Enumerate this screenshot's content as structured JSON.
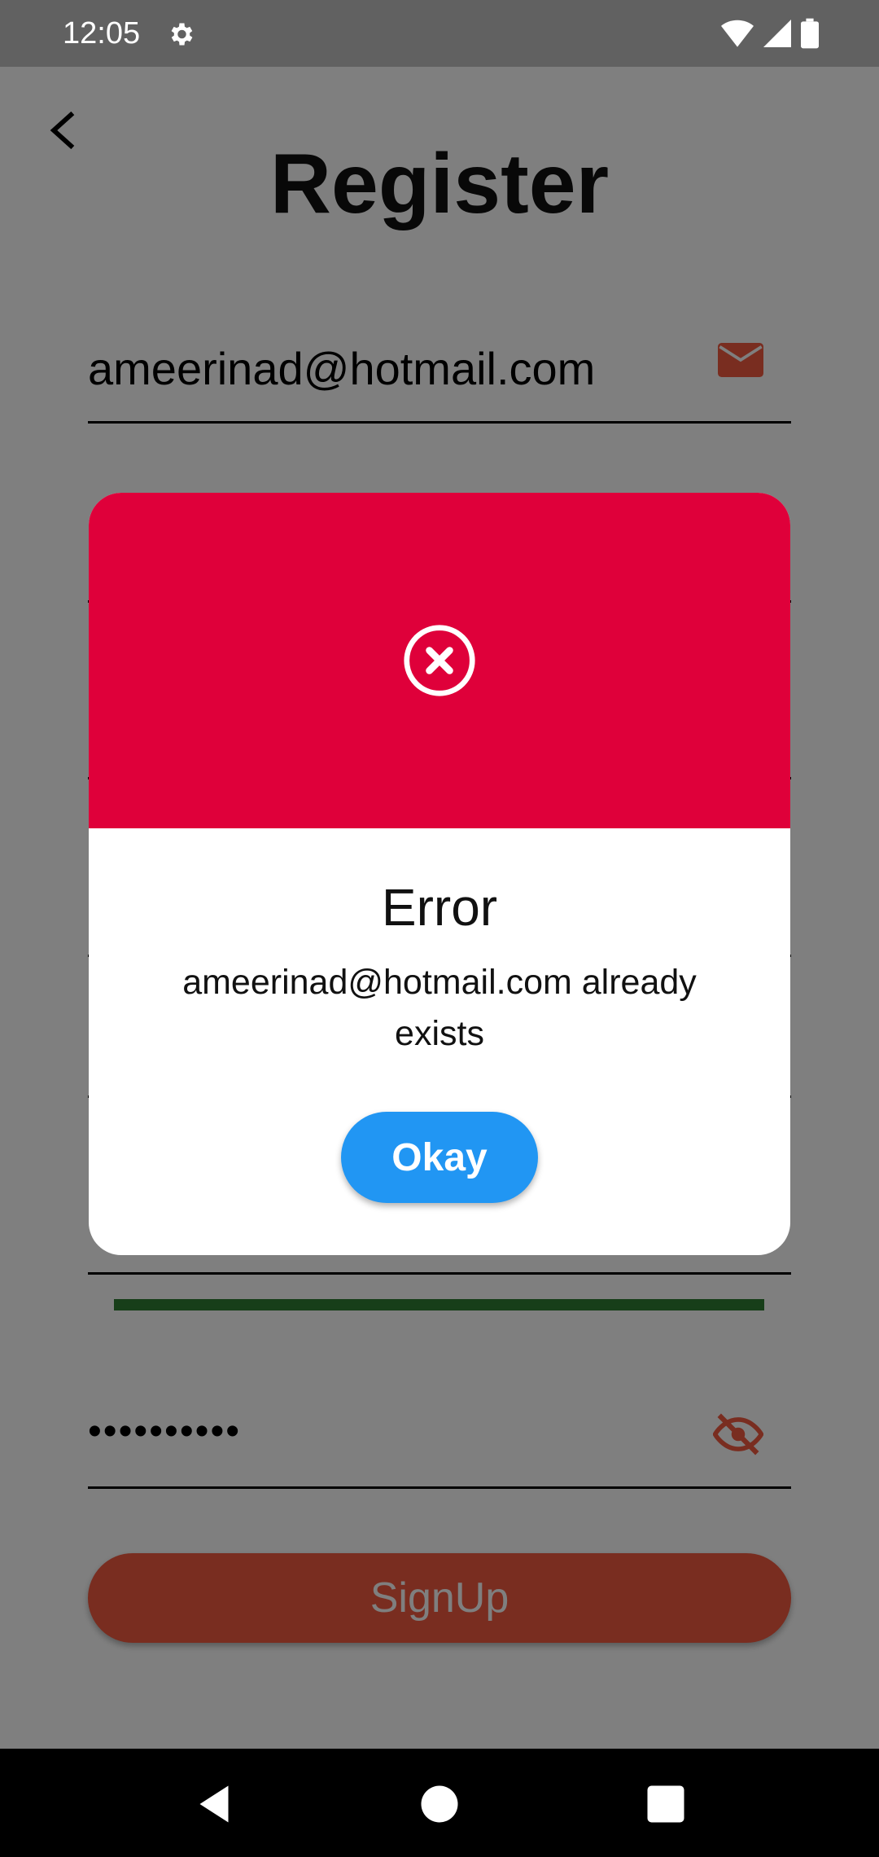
{
  "status_bar": {
    "time": "12:05",
    "icons": [
      "gear-icon",
      "wifi-icon",
      "signal-icon",
      "battery-icon"
    ]
  },
  "header": {
    "title": "Register",
    "back_icon": "chevron-left-icon"
  },
  "form": {
    "email_value": "ameerinad@hotmail.com",
    "email_icon": "mail-icon",
    "password_value": "••••••••••",
    "password_icon": "eye-off-icon",
    "strength_color": "#2e7d32",
    "signup_label": "SignUp"
  },
  "dialog": {
    "title": "Error",
    "message": "ameerinad@hotmail.com already exists",
    "button_label": "Okay",
    "header_color": "#df003a",
    "button_color": "#2196f3",
    "icon": "error-circle-x-icon"
  },
  "nav_bar": {
    "buttons": [
      "back-triangle-icon",
      "home-circle-icon",
      "recents-square-icon"
    ]
  },
  "colors": {
    "accent": "#f25a40",
    "overlay": "rgba(0,0,0,0.5)"
  }
}
